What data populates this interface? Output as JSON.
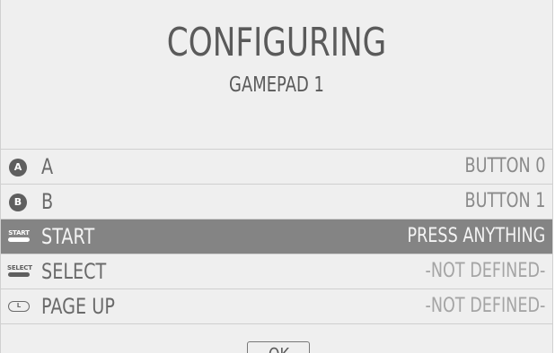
{
  "dialog": {
    "title": "CONFIGURING",
    "subtitle": "GAMEPAD 1"
  },
  "inputs": [
    {
      "icon": "button-a-icon",
      "icon_text": "A",
      "label": "A",
      "value": "BUTTON 0",
      "state": "mapped"
    },
    {
      "icon": "button-b-icon",
      "icon_text": "B",
      "label": "B",
      "value": "BUTTON 1",
      "state": "mapped"
    },
    {
      "icon": "start-button-icon",
      "icon_text": "START",
      "label": "START",
      "value": "PRESS ANYTHING",
      "state": "selected"
    },
    {
      "icon": "select-button-icon",
      "icon_text": "SELECT",
      "label": "SELECT",
      "value": "-NOT DEFINED-",
      "state": "undefined"
    },
    {
      "icon": "shoulder-l-icon",
      "icon_text": "L",
      "label": "PAGE UP",
      "value": "-NOT DEFINED-",
      "state": "undefined"
    }
  ],
  "footer": {
    "ok_label": "OK"
  },
  "colors": {
    "background": "#efefef",
    "selected_row": "#848484",
    "text": "#5a5a5a"
  }
}
